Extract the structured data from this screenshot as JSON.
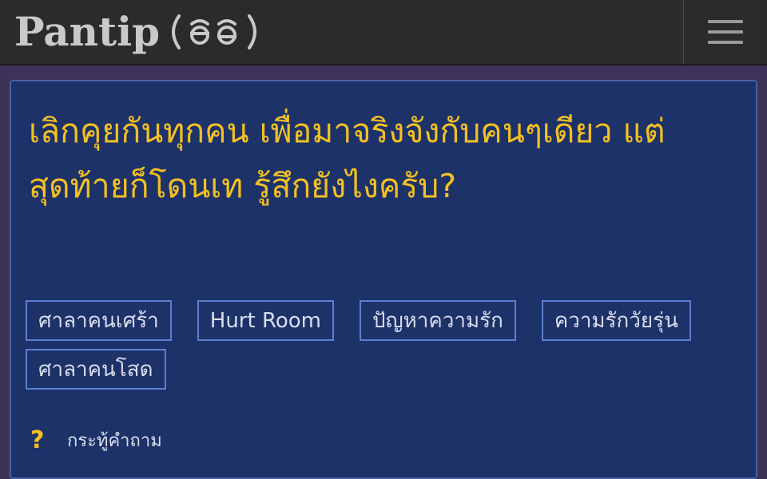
{
  "header": {
    "logo_text": "Pantip",
    "logo_icon": "pantip-logo-mark",
    "menu_icon": "hamburger-menu-icon"
  },
  "topic": {
    "title": "เลิกคุยกันทุกคน เพื่อมาจริงจังกับคนๆเดียว แต่สุดท้ายก็โดนเท รู้สึกยังไงครับ?",
    "tags": [
      "ศาลาคนเศร้า",
      "Hurt Room",
      "ปัญหาความรัก",
      "ความรักวัยรุ่น",
      "ศาลาคนโสด"
    ],
    "type_icon": "question-mark-icon",
    "type_label": "กระทู้คำถาม"
  },
  "colors": {
    "header_bg": "#2b2b2b",
    "card_bg": "#1d3268",
    "title": "#f3c022",
    "tag_border": "#5c7fd0",
    "page_bg": "#3d3358"
  }
}
